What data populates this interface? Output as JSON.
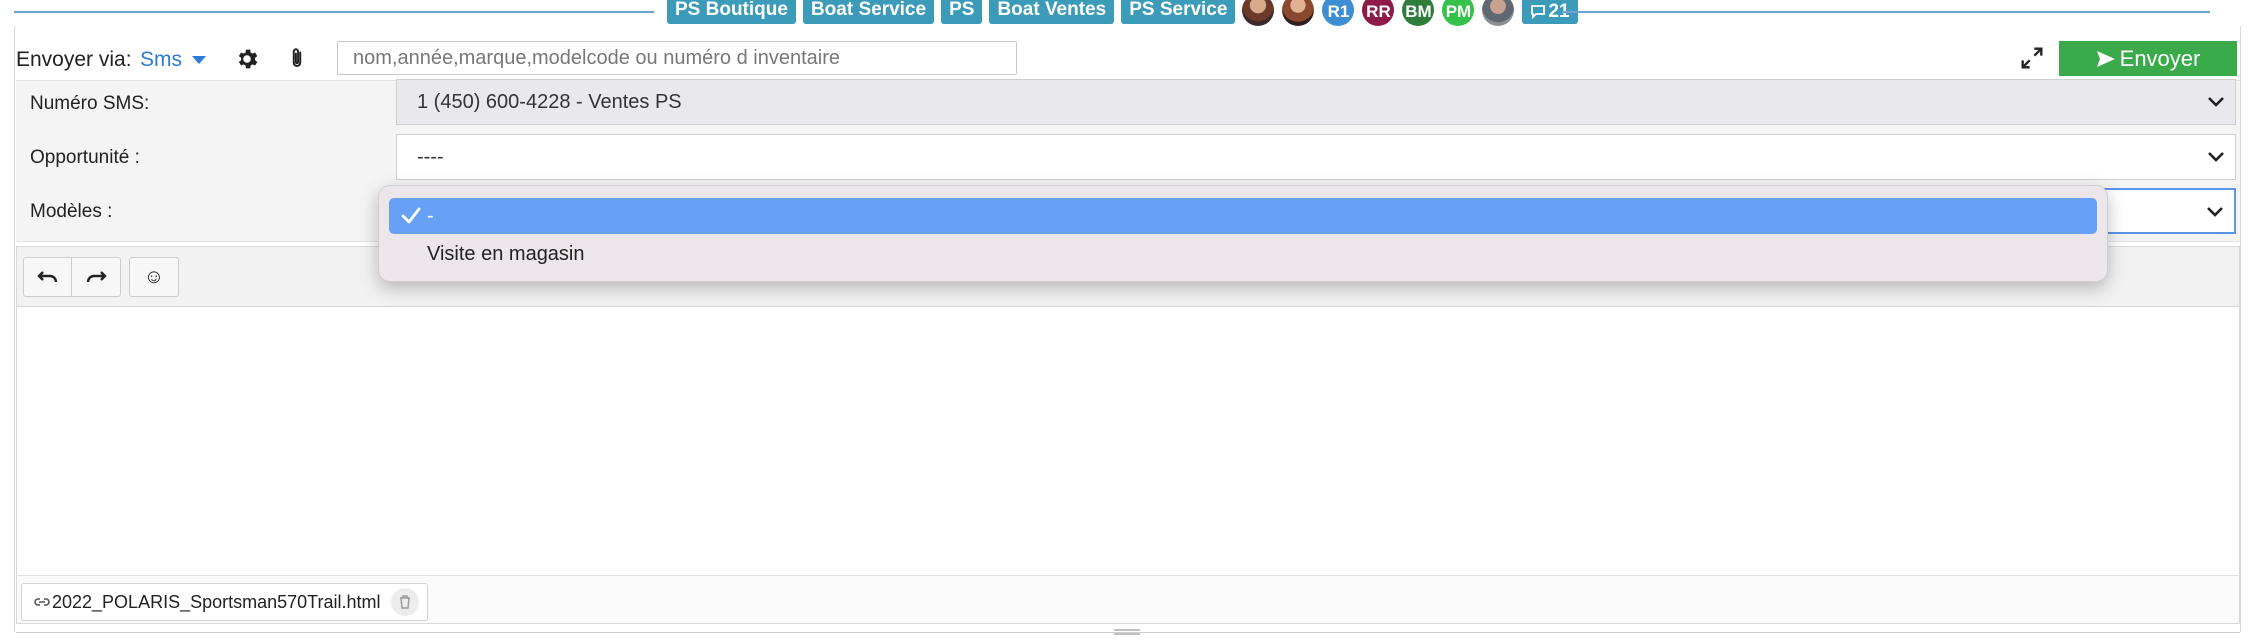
{
  "topbar": {
    "tags": [
      "PS Boutique",
      "Boat Service",
      "PS",
      "Boat Ventes",
      "PS Service"
    ],
    "avatars": [
      {
        "initials": "",
        "color": "#5a3b33",
        "icon": "user-photo"
      },
      {
        "initials": "",
        "color": "#8b4a2f",
        "icon": "user-photo"
      },
      {
        "initials": "R1",
        "color": "#3d8fd1"
      },
      {
        "initials": "RR",
        "color": "#8c1b4a"
      },
      {
        "initials": "BM",
        "color": "#2e7d3b"
      },
      {
        "initials": "PM",
        "color": "#34c24a"
      },
      {
        "initials": "",
        "color": "#6a7078",
        "icon": "user-photo"
      }
    ],
    "chat_count": "21",
    "chat_icon": "chat-bubble-icon"
  },
  "send_row": {
    "label": "Envoyer via:",
    "channel": "Sms",
    "search_placeholder": "nom,année,marque,modelcode ou numéro d inventaire",
    "send_label": "Envoyer"
  },
  "form": {
    "sms_number_label": "Numéro SMS:",
    "sms_number_value": "1 (450) 600-4228 - Ventes PS",
    "opportunity_label": "Opportunité :",
    "opportunity_value": "----",
    "templates_label": "Modèles :",
    "templates_value": "-"
  },
  "dropdown": {
    "options": [
      "-",
      "Visite en magasin"
    ],
    "selected_index": 0
  },
  "editor": {
    "undo_icon": "undo-icon",
    "redo_icon": "redo-icon",
    "emoji_label": "☺",
    "body_text": ""
  },
  "attachment": {
    "filename": "2022_POLARIS_Sportsman570Trail.html"
  },
  "colors": {
    "tag_bg": "#3d9bba",
    "send_button": "#3aaa4a",
    "link_blue": "#2a7ad6",
    "dropdown_selected": "#66a1f5"
  }
}
